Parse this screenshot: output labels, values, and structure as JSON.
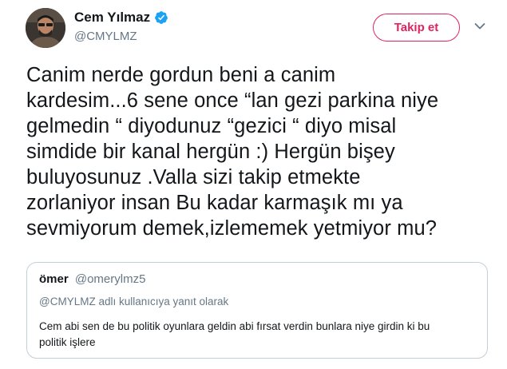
{
  "author": {
    "name": "Cem Yılmaz",
    "handle": "@CMYLMZ",
    "verified": true,
    "avatar_icon": "user-photo"
  },
  "actions": {
    "follow_label": "Takip et",
    "more_icon": "chevron-down-icon"
  },
  "tweet": {
    "lines": [
      "Canim nerde gordun beni a canim",
      "kardesim...6 sene once “lan gezi parkina niye",
      "gelmedin “ diyodunuz “gezici “ diyo misal",
      "simdide bir kanal hergün :) Hergün bişey",
      "buluyosunuz .Valla sizi takip etmekte",
      "zorlaniyor insan Bu kadar karmaşık mı ya",
      "sevmiyorum demek,izlememek yetmiyor mu?"
    ]
  },
  "quote": {
    "name": "ömer",
    "handle": "@omerylmz5",
    "reply_context": "@CMYLMZ adlı kullanıcıya yanıt olarak",
    "lines": [
      "Cem abi sen de bu politik oyunlara geldin abi fırsat verdin bunlara niye girdin ki bu",
      "politik işlere"
    ]
  },
  "colors": {
    "accent": "#e0245e",
    "verified": "#1da1f2",
    "secondary_text": "#657786",
    "border": "#c4cfd6"
  }
}
